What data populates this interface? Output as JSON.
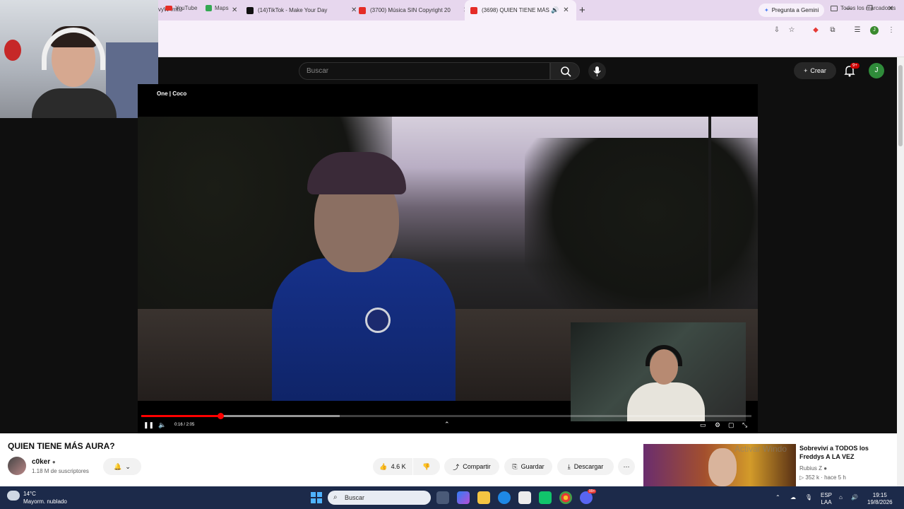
{
  "browser": {
    "tabs": [
      {
        "title": "",
        "favicon_color": "#999999"
      },
      {
        "title": "(14)TikTok - Make Your Day",
        "favicon_color": "#111111"
      },
      {
        "title": "(3700) Música SIN Copyright 20",
        "favicon_color": "#e52d27"
      },
      {
        "title": "(3698) QUIEN TIENE MÁS A",
        "favicon_color": "#e52d27",
        "active": true
      }
    ],
    "new_tab": "+",
    "gemini_label": "Pregunta a Gemini",
    "url": "vyW4mtU",
    "profile_initial": "J",
    "bookmarks": [
      {
        "label": "YouTube",
        "icon": "youtube-icon"
      },
      {
        "label": "Maps",
        "icon": "maps-icon"
      }
    ],
    "all_bookmarks": "Todos los marcadores"
  },
  "youtube": {
    "search_placeholder": "Buscar",
    "create_label": "Crear",
    "notif_badge": "9+",
    "avatar_initial": "J"
  },
  "player": {
    "overlay_text": "One | Coco",
    "time": "0:16 / 2:05",
    "progress_fraction": 0.13,
    "buffered_fraction": 0.325
  },
  "video": {
    "title": "QUIEN TIENE MÁS AURA?",
    "channel": "c0ker",
    "subscribers": "1.18 M de suscriptores",
    "likes": "4.6 K",
    "share": "Compartir",
    "save": "Guardar",
    "download": "Descargar"
  },
  "recommendation": {
    "title": "Sobreviví a TODOS los Freddys A LA VEZ",
    "channel": "Rubius Z",
    "meta": "352 k · hace 5 h",
    "watermark": "Activar Windo"
  },
  "taskbar": {
    "temp": "14°C",
    "weather": "Mayorm. nublado",
    "search": "Buscar",
    "lang_top": "ESP",
    "lang_bottom": "LAA",
    "time": "19:15",
    "date": "19/8/2026",
    "badge": "99+"
  },
  "colors": {
    "youtube_red": "#ff0000",
    "taskbar": "#1c2a4a",
    "tab_strip": "#e7d7ee"
  }
}
